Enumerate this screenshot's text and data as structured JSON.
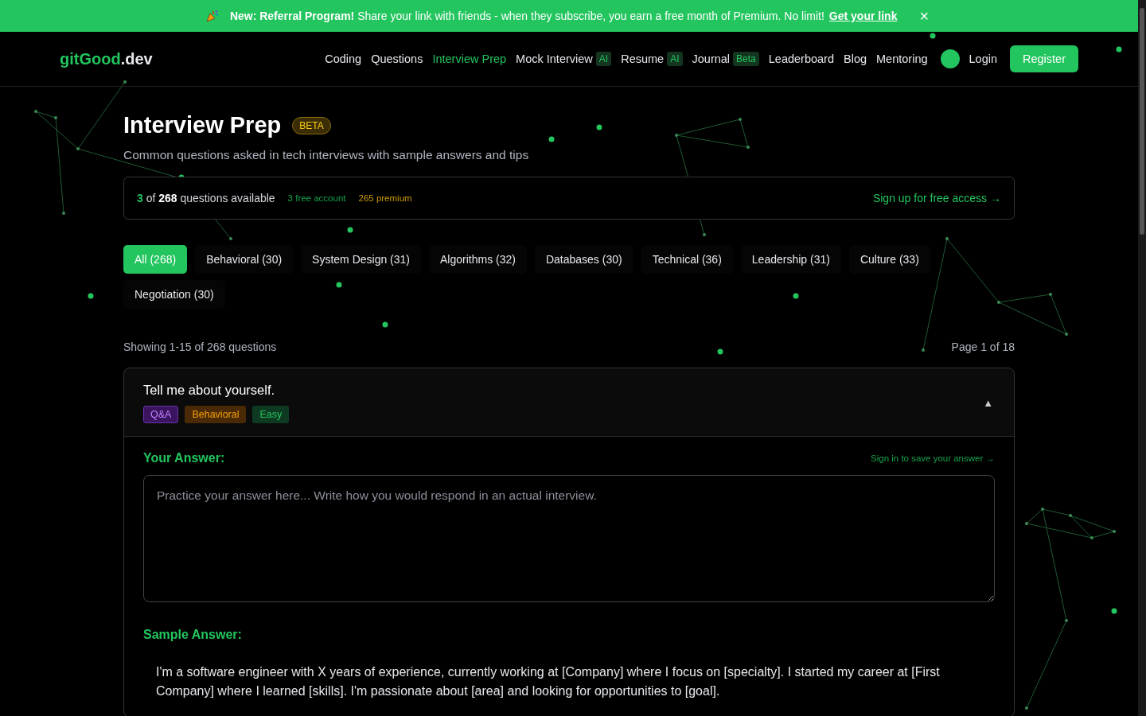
{
  "banner": {
    "message": "**New: Referral Program!** Share your link with friends - when they subscribe, you earn a free month of Premium. No limit!",
    "link": "Get your link",
    "close": "×"
  },
  "nav": {
    "logo_main": "gitGood",
    "logo_suffix": ".dev",
    "items": [
      {
        "label": "Coding",
        "selected": false
      },
      {
        "label": "Questions",
        "selected": false
      },
      {
        "label": "Interview Prep",
        "selected": true
      },
      {
        "label": "Mock Interview",
        "selected": false,
        "badge": "AI"
      },
      {
        "label": "Resume",
        "selected": false,
        "badge": "AI"
      },
      {
        "label": "Journal",
        "selected": false,
        "badge": "Beta"
      },
      {
        "label": "Leaderboard",
        "selected": false
      },
      {
        "label": "Blog",
        "selected": false
      },
      {
        "label": "Mentoring",
        "selected": false
      }
    ],
    "login": "Login",
    "register": "Register"
  },
  "header": {
    "title": "Interview Prep",
    "badge": "BETA",
    "subtitle": "Common questions asked in tech interviews with sample answers and tips"
  },
  "access": {
    "count": "3",
    "text": "of **268** questions available",
    "free": "3 free account",
    "premium": "265 premium",
    "link": "Sign up for free access →"
  },
  "categories": [
    {
      "label": "All (268)",
      "selected": true
    },
    {
      "label": "Behavioral (30)",
      "selected": false
    },
    {
      "label": "System Design (31)",
      "selected": false
    },
    {
      "label": "Algorithms (32)",
      "selected": false
    },
    {
      "label": "Databases (30)",
      "selected": false
    },
    {
      "label": "Technical (36)",
      "selected": false
    },
    {
      "label": "Leadership (31)",
      "selected": false
    },
    {
      "label": "Culture (33)",
      "selected": false
    },
    {
      "label": "Negotiation (30)",
      "selected": false
    }
  ],
  "summary": {
    "showing": "Showing 1-15 of 268 questions",
    "page": "Page 1 of 18"
  },
  "question": {
    "title": "Tell me about yourself.",
    "expanded": true,
    "toggle": "▲",
    "tags": [
      {
        "label": "Q&A",
        "kind": "type"
      },
      {
        "label": "Behavioral",
        "kind": "category"
      },
      {
        "label": "Easy",
        "kind": "difficulty"
      }
    ],
    "answer_label": "Your Answer:",
    "save_link": "Sign in to save your answer →",
    "answer_field": {
      "placeholder": "Practice your answer here... Write how you would respond in an actual interview."
    },
    "sample_label": "Sample Answer:",
    "sample_text": "I'm a software engineer with X years of experience, currently working at [Company] where I focus on [specialty]. I started my career at [First Company] where I learned [skills]. I'm passionate about [area] and looking for opportunities to [goal]."
  }
}
